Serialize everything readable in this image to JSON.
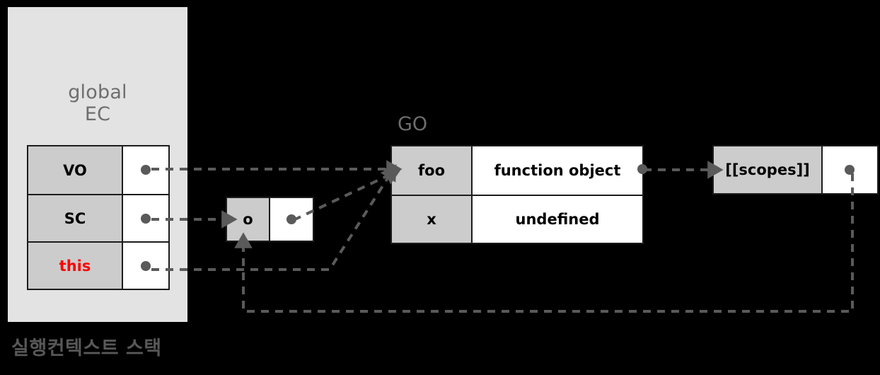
{
  "diagram": {
    "background_color": "#000000",
    "panel_color": "#E3E3E3",
    "key_cell_color": "#CCCCCC",
    "wire_color": "#5A5A5A",
    "label_color": "#6E6E6E",
    "highlight_color": "#FF0000",
    "caption": "실행컨텍스트 스택"
  },
  "execution_context": {
    "title": "global\nEC",
    "rows": [
      {
        "key": "VO",
        "value": "",
        "highlight": false
      },
      {
        "key": "SC",
        "value": "",
        "highlight": false
      },
      {
        "key": "this",
        "value": "",
        "highlight": true
      }
    ]
  },
  "o_object": {
    "rows": [
      {
        "key": "o",
        "value": ""
      }
    ]
  },
  "global_object": {
    "title": "GO",
    "rows": [
      {
        "key": "foo",
        "value": "function object"
      },
      {
        "key": "x",
        "value": "undefined"
      }
    ]
  },
  "scopes": {
    "rows": [
      {
        "key": "[[scopes]]",
        "value": ""
      }
    ]
  }
}
